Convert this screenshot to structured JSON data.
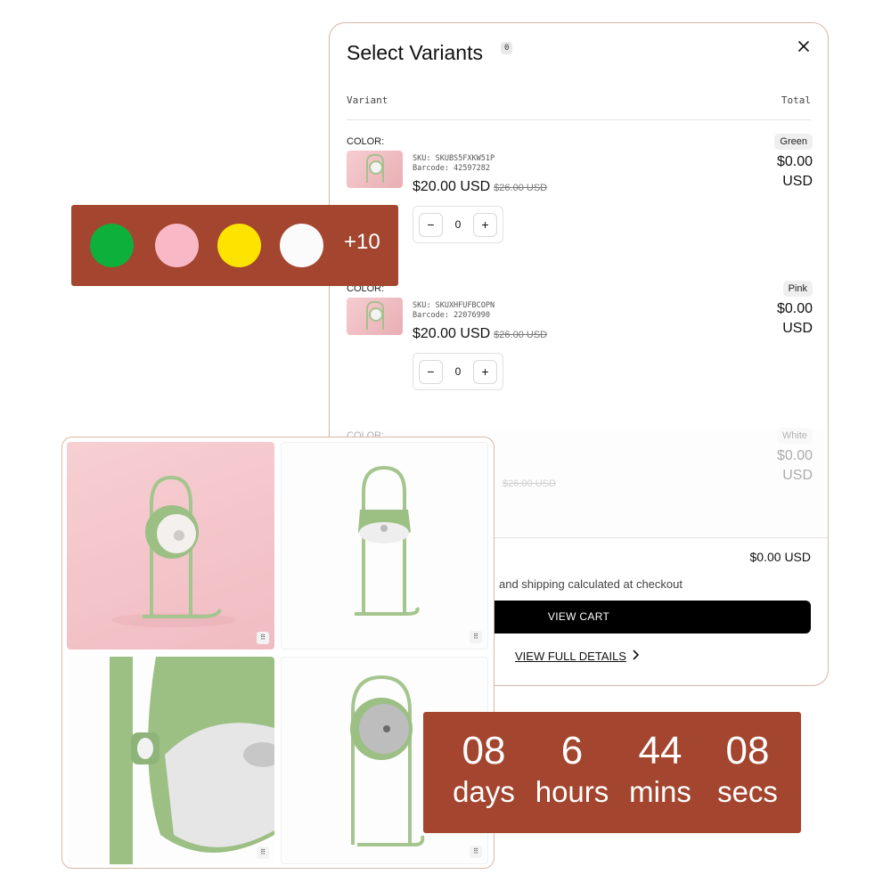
{
  "modal": {
    "title": "Select Variants",
    "count_badge": "0",
    "close_icon": "close-icon",
    "columns": {
      "variant": "Variant",
      "total": "Total"
    },
    "variants": [
      {
        "option_label": "COLOR:",
        "option_value": "Green",
        "sku": "SKU: SKUBS5FXKW51P",
        "barcode": "Barcode: 42597282",
        "price": "$20.00 USD",
        "compare_price": "$26.00 USD",
        "total_amount": "$0.00",
        "total_currency": "USD",
        "quantity": "0",
        "minus": "−",
        "plus": "+"
      },
      {
        "option_label": "COLOR:",
        "option_value": "Pink",
        "sku": "SKU: SKUXHFUFBCOPN",
        "barcode": "Barcode: 22076990",
        "price": "$20.00 USD",
        "compare_price": "$26.00 USD",
        "total_amount": "$0.00",
        "total_currency": "USD",
        "quantity": "0",
        "minus": "−",
        "plus": "+"
      },
      {
        "option_label": "COLOR:",
        "option_value": "White",
        "sku": "",
        "barcode": "",
        "price": "",
        "compare_price": "$26.00 USD",
        "total_amount": "$0.00",
        "total_currency": "USD"
      }
    ],
    "subtotal": "$0.00 USD",
    "tax_note": "and shipping calculated at checkout",
    "view_cart": "VIEW CART",
    "view_details": "VIEW FULL DETAILS",
    "chevron": "›"
  },
  "swatches": {
    "colors": [
      "#0db03b",
      "#f8b8c5",
      "#fde300",
      "#fbfbfb"
    ],
    "more": "+10"
  },
  "gallery": {
    "zoom_icon": "⠿",
    "lamp_color": "#9cbf84",
    "background_pink": "#f3c2c8"
  },
  "countdown": {
    "days": "08",
    "days_label": "days",
    "hours": "6",
    "hours_label": "hours",
    "mins": "44",
    "mins_label": "mins",
    "secs": "08",
    "secs_label": "secs"
  },
  "colors": {
    "accent": "#a3452f",
    "border": "#d8b7a6"
  }
}
